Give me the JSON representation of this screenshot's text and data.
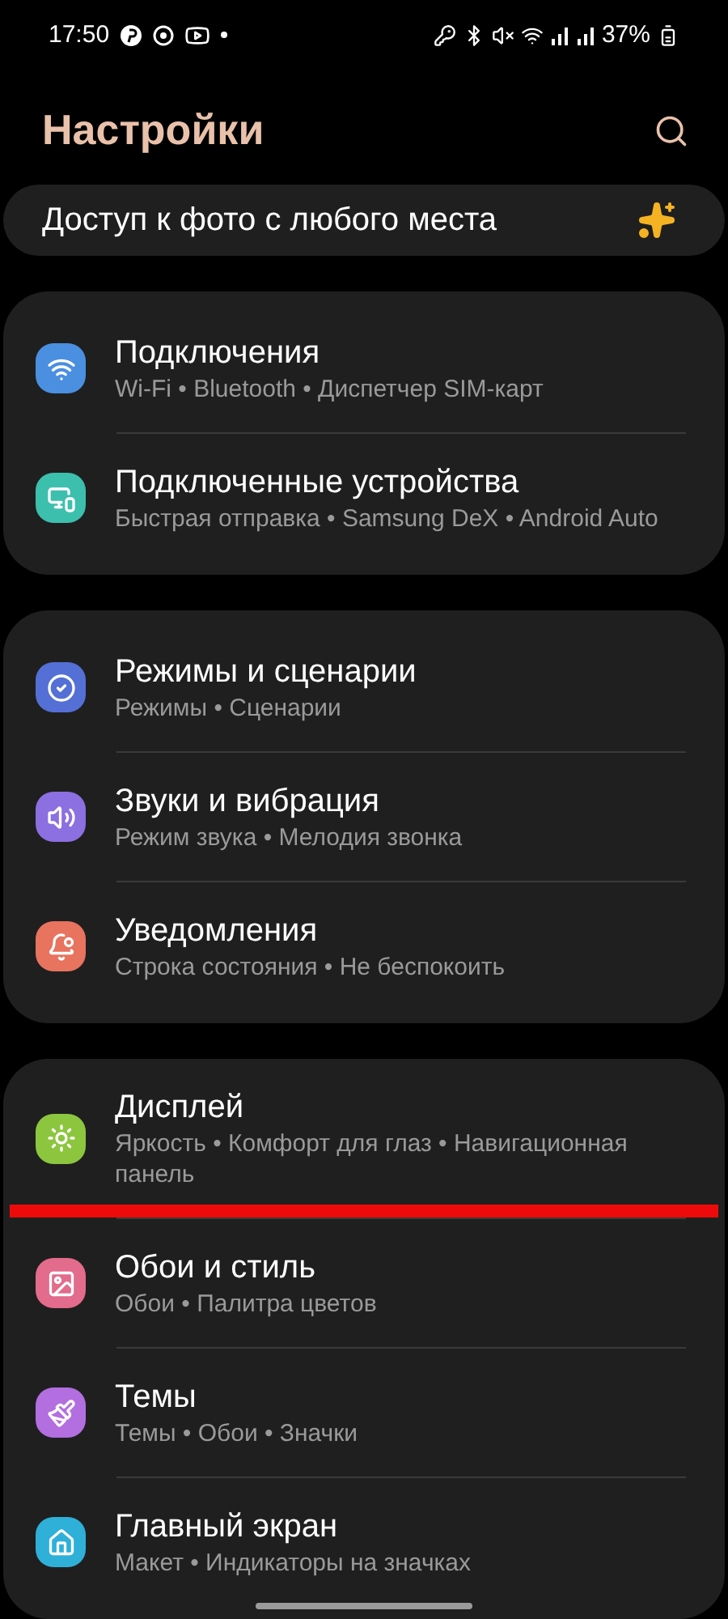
{
  "status_bar": {
    "time": "17:50",
    "battery": "37%"
  },
  "header": {
    "title": "Настройки"
  },
  "promo": {
    "text": "Доступ к фото с любого места"
  },
  "groups": [
    {
      "items": [
        {
          "title": "Подключения",
          "subtitle": "Wi-Fi • Bluetooth • Диспетчер SIM-карт",
          "color": "#4a8fe0"
        },
        {
          "title": "Подключенные устройства",
          "subtitle": "Быстрая отправка • Samsung DeX • Android Auto",
          "color": "#3dbfae"
        }
      ]
    },
    {
      "items": [
        {
          "title": "Режимы и сценарии",
          "subtitle": "Режимы • Сценарии",
          "color": "#5470d6"
        },
        {
          "title": "Звуки и вибрация",
          "subtitle": "Режим звука • Мелодия звонка",
          "color": "#8c6fe0"
        },
        {
          "title": "Уведомления",
          "subtitle": "Строка состояния • Не беспокоить",
          "color": "#e8735e"
        }
      ]
    },
    {
      "items": [
        {
          "title": "Дисплей",
          "subtitle": "Яркость • Комфорт для глаз • Навигационная панель",
          "color": "#8cc63f"
        },
        {
          "title": "Обои и стиль",
          "subtitle": "Обои • Палитра цветов",
          "color": "#e36b8c"
        },
        {
          "title": "Темы",
          "subtitle": "Темы • Обои • Значки",
          "color": "#b36ee0"
        },
        {
          "title": "Главный экран",
          "subtitle": "Макет • Индикаторы на значках",
          "color": "#2fb0d8"
        }
      ]
    }
  ]
}
